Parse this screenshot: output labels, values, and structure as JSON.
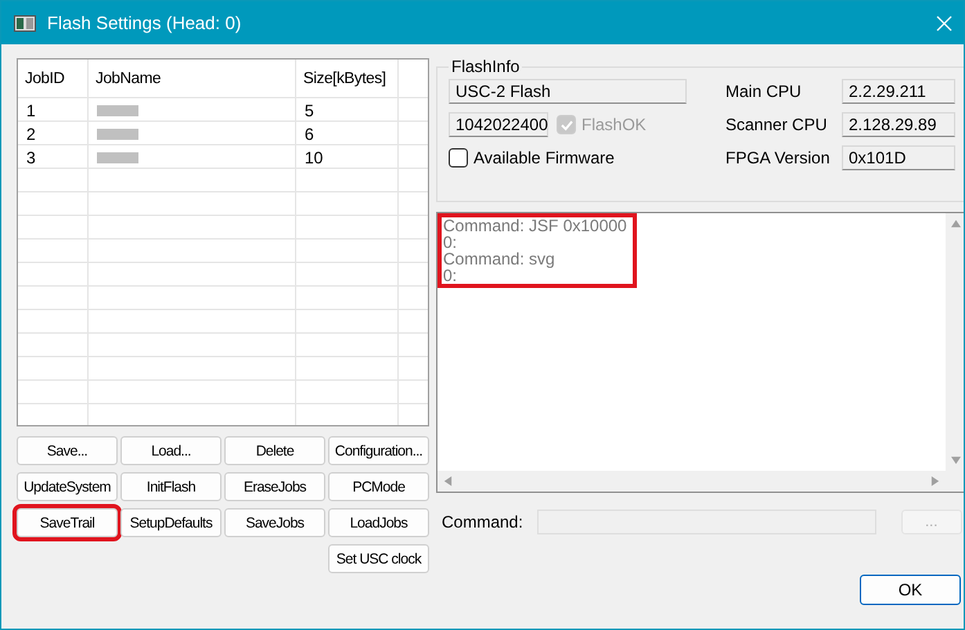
{
  "window": {
    "title": "Flash Settings (Head: 0)"
  },
  "jobs_table": {
    "columns": [
      "JobID",
      "JobName",
      "Size[kBytes]"
    ],
    "rows": [
      {
        "id": "1",
        "name_hidden": true,
        "size": "5"
      },
      {
        "id": "2",
        "name_hidden": true,
        "size": "6"
      },
      {
        "id": "3",
        "name_hidden": true,
        "size": "10"
      }
    ]
  },
  "buttons": [
    {
      "label": "Save...",
      "highlighted": false
    },
    {
      "label": "Load...",
      "highlighted": false
    },
    {
      "label": "Delete",
      "highlighted": false
    },
    {
      "label": "Configuration...",
      "highlighted": false
    },
    {
      "label": "UpdateSystem",
      "highlighted": false
    },
    {
      "label": "InitFlash",
      "highlighted": false
    },
    {
      "label": "EraseJobs",
      "highlighted": false
    },
    {
      "label": "PCMode",
      "highlighted": false
    },
    {
      "label": "SaveTrail",
      "highlighted": true
    },
    {
      "label": "SetupDefaults",
      "highlighted": false
    },
    {
      "label": "SaveJobs",
      "highlighted": false
    },
    {
      "label": "LoadJobs",
      "highlighted": false
    },
    {
      "label": "Set USC clock",
      "highlighted": false
    }
  ],
  "flash_info": {
    "title": "FlashInfo",
    "device": "USC-2 Flash",
    "size": "1042022400",
    "flash_ok": {
      "label": "FlashOK",
      "checked": true,
      "disabled": true
    },
    "available_firmware": {
      "label": "Available Firmware",
      "checked": false
    },
    "versions": [
      {
        "label": "Main CPU",
        "value": "2.2.29.211"
      },
      {
        "label": "Scanner CPU",
        "value": "2.128.29.89"
      },
      {
        "label": "FPGA Version",
        "value": "0x101D"
      }
    ]
  },
  "log": {
    "highlighted": true,
    "lines": [
      "Command: JSF 0x10000",
      "0:",
      "Command: svg",
      "0:"
    ]
  },
  "command": {
    "label": "Command:",
    "disabled": true,
    "browse_label": "..."
  },
  "ok_button": "OK"
}
